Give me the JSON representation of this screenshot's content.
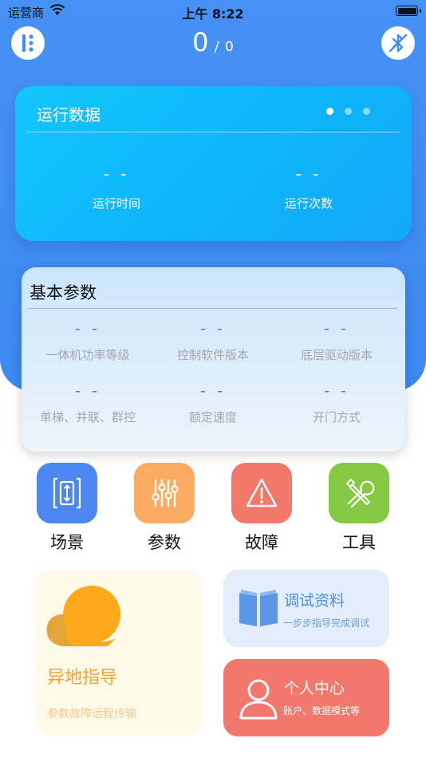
{
  "status_bar": {
    "carrier": "运营商",
    "time": "上午 8:22"
  },
  "header": {
    "count": "0",
    "total": "0"
  },
  "run_data": {
    "title": "运行数据",
    "page_count": 3,
    "active_page": 1,
    "items": [
      {
        "value": "- -",
        "label": "运行时间"
      },
      {
        "value": "- -",
        "label": "运行次数"
      }
    ]
  },
  "basic_params": {
    "title": "基本参数",
    "items": [
      {
        "value": "- -",
        "label": "一体机功率等级"
      },
      {
        "value": "- -",
        "label": "控制软件版本"
      },
      {
        "value": "- -",
        "label": "底层驱动版本"
      },
      {
        "value": "- -",
        "label": "单梯、并联、群控"
      },
      {
        "value": "- -",
        "label": "额定速度"
      },
      {
        "value": "- -",
        "label": "开门方式"
      }
    ]
  },
  "menu": [
    {
      "label": "场景",
      "icon": "elevator-icon",
      "color": "#4b86f1"
    },
    {
      "label": "参数",
      "icon": "sliders-icon",
      "color": "#fbaa62"
    },
    {
      "label": "故障",
      "icon": "warning-icon",
      "color": "#f3786c"
    },
    {
      "label": "工具",
      "icon": "tools-icon",
      "color": "#84c844"
    }
  ],
  "cards": {
    "remote": {
      "title": "异地指导",
      "subtitle": "参数故障远程传输",
      "icon": "chat-bubbles-icon"
    },
    "docs": {
      "title": "调试资料",
      "subtitle": "一步步指导完成调试",
      "icon": "book-icon"
    },
    "personal": {
      "title": "个人中心",
      "subtitle": "账户、数据模式等",
      "icon": "user-icon"
    }
  },
  "colors": {
    "primary": "#3f8cf3",
    "accent_blue": "#3a86e6",
    "card_cyan": "#0db6fb"
  }
}
